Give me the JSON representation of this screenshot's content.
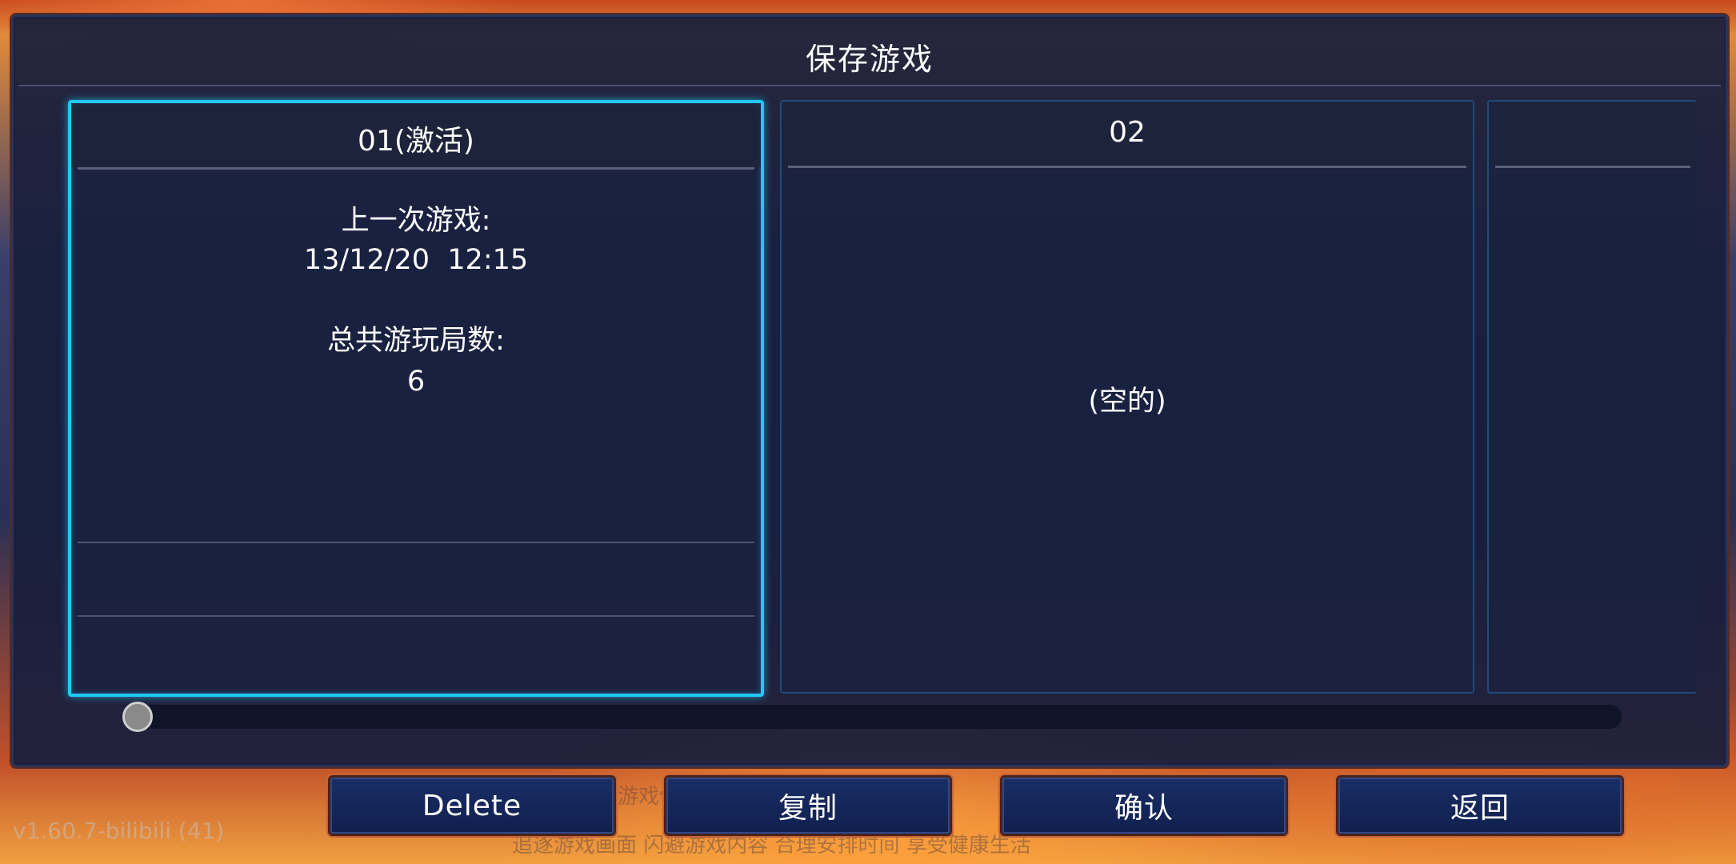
{
  "dialog": {
    "title": "保存游戏"
  },
  "slots": [
    {
      "name": "01(激活)",
      "last_played_label": "上一次游戏:",
      "last_played_value": "13/12/20  12:15",
      "total_runs_label": "总共游玩局数:",
      "total_runs_value": "6"
    },
    {
      "name": "02",
      "empty_label": "(空的)"
    },
    {
      "name": ""
    }
  ],
  "scrollbar": {
    "position": 0.0
  },
  "buttons": {
    "delete": "Delete",
    "copy": "复制",
    "confirm": "确认",
    "back": "返回"
  },
  "version": "v1.60.7-bilibili  (41)",
  "background_ticker": "追逐游戏画面 闪避游戏内容 合理安排时间 享受健康生活",
  "background_ticker_2": "沉迷游戏伤身 适度游戏益脑"
}
